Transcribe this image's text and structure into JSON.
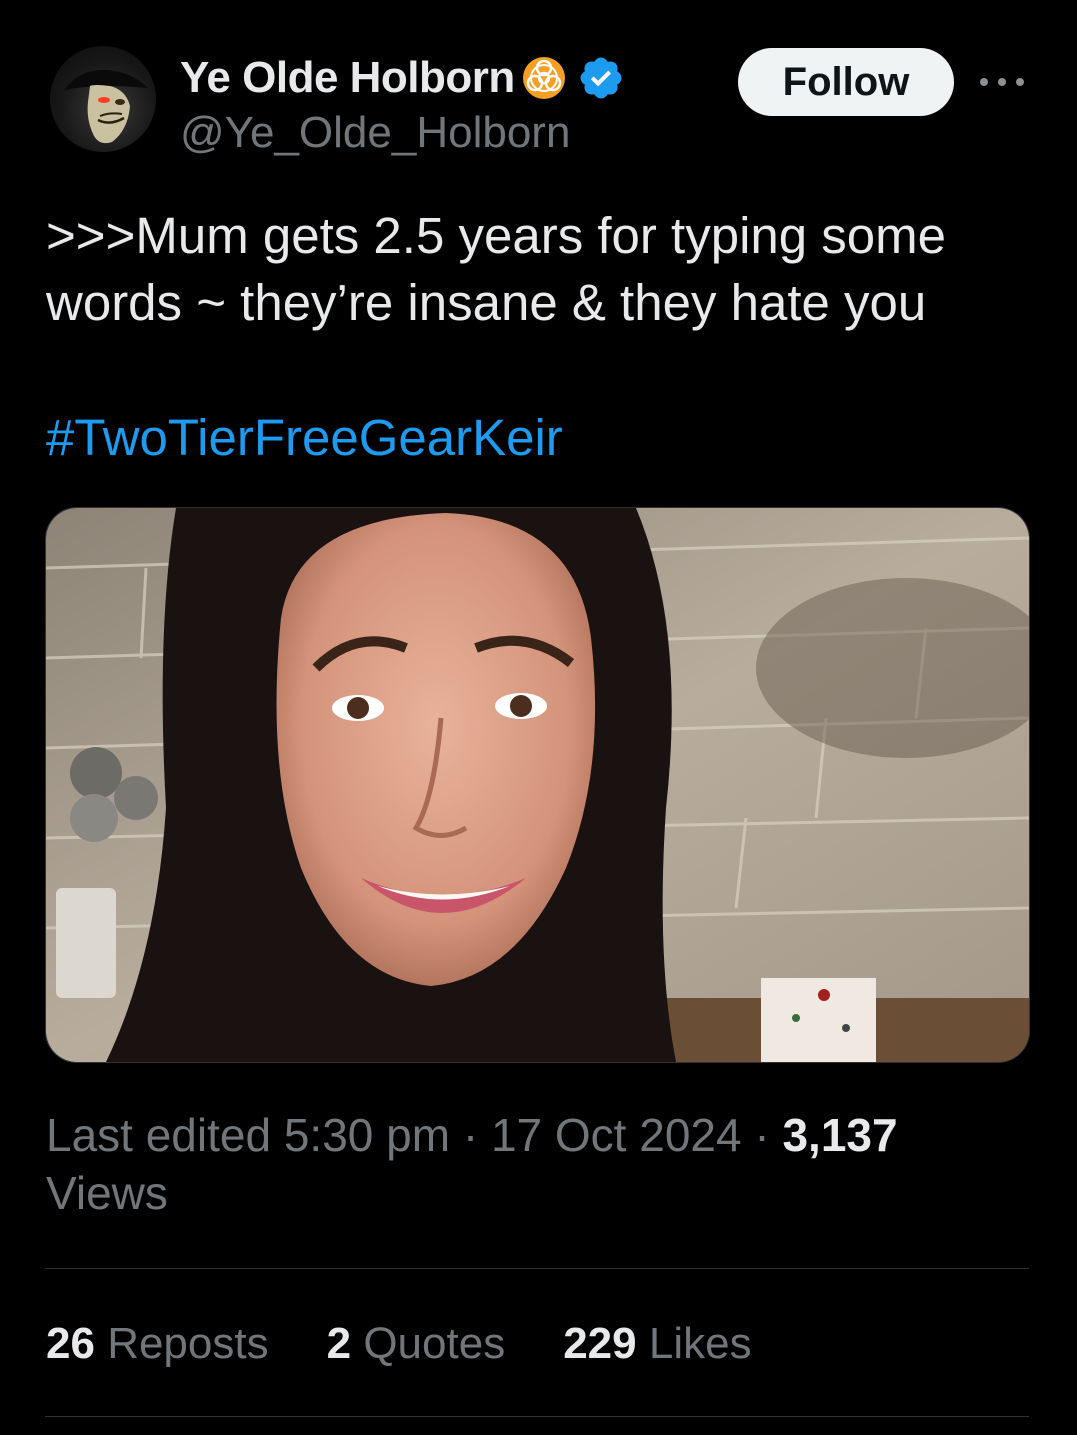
{
  "author": {
    "display_name": "Ye Olde Holborn",
    "handle": "@Ye_Olde_Holborn",
    "badge_icon": "biohazard-icon",
    "verified_icon": "verified-badge-icon",
    "verified_color": "#1d9bf0",
    "badge_color": "#f4a024"
  },
  "actions": {
    "follow_label": "Follow",
    "more_icon": "more-options-icon"
  },
  "tweet": {
    "text": ">>>Mum gets 2.5 years for typing some words ~ they’re insane & they hate you",
    "hashtag": "#TwoTierFreeGearKeir",
    "hashtag_color": "#1d9bf0"
  },
  "meta": {
    "edited_prefix": "Last edited ",
    "time": "5:30 pm",
    "separator": " · ",
    "date": "17 Oct 2024",
    "views_count": "3,137",
    "views_label": "Views"
  },
  "stats": {
    "reposts_count": "26",
    "reposts_label": "Reposts",
    "quotes_count": "2",
    "quotes_label": "Quotes",
    "likes_count": "229",
    "likes_label": "Likes"
  },
  "colors": {
    "background": "#000000",
    "text_primary": "#e7e9ea",
    "text_secondary": "#71767b",
    "divider": "#2f3336",
    "link": "#1d9bf0"
  }
}
